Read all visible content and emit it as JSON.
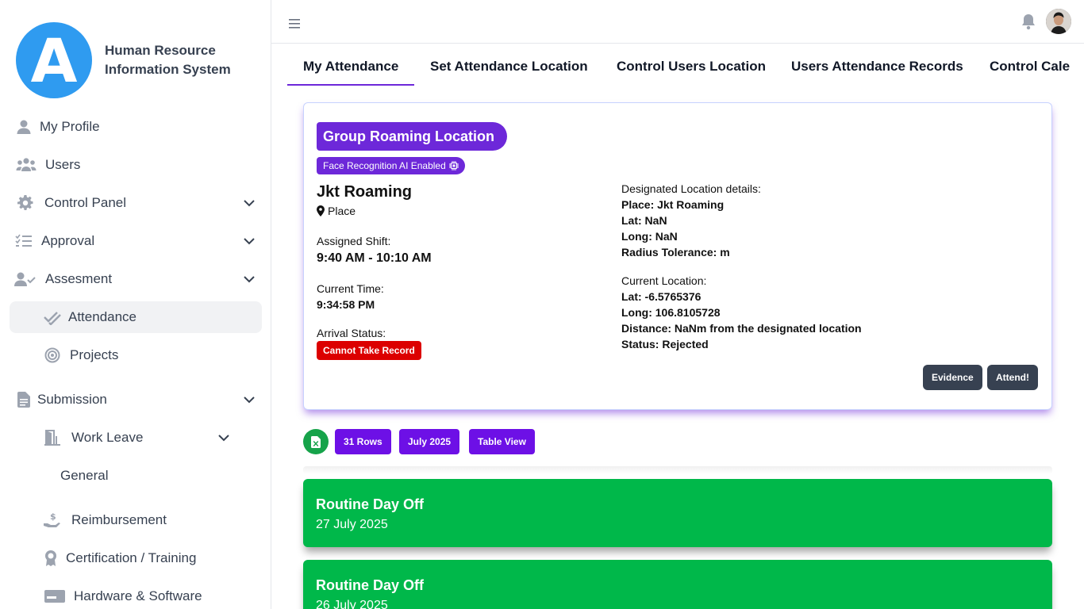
{
  "brand": {
    "logo_letter": "A",
    "title": "Human Resource Information System",
    "logo_color": "#2f9bf0"
  },
  "sidebar": {
    "items": [
      {
        "label": "My Profile",
        "icon": "user-icon"
      },
      {
        "label": "Users",
        "icon": "users-icon"
      },
      {
        "label": "Control Panel",
        "icon": "gear-icon"
      },
      {
        "label": "Approval",
        "icon": "checklist-icon"
      },
      {
        "label": "Assesment",
        "icon": "user-check-icon"
      },
      {
        "label": "Attendance",
        "icon": "double-check-icon"
      },
      {
        "label": "Projects",
        "icon": "target-icon"
      },
      {
        "label": "Submission",
        "icon": "document-icon"
      },
      {
        "label": "Work Leave",
        "icon": "door-icon"
      },
      {
        "label": "General",
        "icon": ""
      },
      {
        "label": "Reimbursement",
        "icon": "hand-dollar-icon"
      },
      {
        "label": "Certification / Training",
        "icon": "award-icon"
      },
      {
        "label": "Hardware & Software",
        "icon": "card-icon"
      }
    ]
  },
  "topbar": {
    "menu_icon": "hamburger-icon",
    "notifications_icon": "bell-icon",
    "avatar": "user-avatar"
  },
  "tabs": [
    {
      "label": "My Attendance",
      "active": true
    },
    {
      "label": "Set Attendance Location"
    },
    {
      "label": "Control Users Location"
    },
    {
      "label": "Users Attendance Records"
    },
    {
      "label": "Control Cale"
    }
  ],
  "card": {
    "group_label": "Group Roaming Location",
    "ai_badge": "Face Recognition AI Enabled",
    "location_name": "Jkt Roaming",
    "place_label": "Place",
    "shift_label": "Assigned Shift:",
    "shift_value": "9:40 AM - 10:10 AM",
    "time_label": "Current Time:",
    "time_value": "9:34:58 PM",
    "arrival_label": "Arrival Status:",
    "arrival_status": "Cannot Take Record",
    "designated": {
      "heading": "Designated Location details:",
      "place": "Place: Jkt Roaming",
      "lat": "Lat: NaN",
      "long": "Long: NaN",
      "radius": "Radius Tolerance: m"
    },
    "current": {
      "heading": "Current Location:",
      "lat": "Lat: -6.5765376",
      "long": "Long: 106.8105728",
      "distance": "Distance: NaNm from the designated location",
      "status": "Status: Rejected"
    },
    "evidence_button": "Evidence",
    "attend_button": "Attend!"
  },
  "toolbar": {
    "excel_icon": "excel-icon",
    "rows_chip": "31 Rows",
    "month_chip": "July 2025",
    "view_chip": "Table View"
  },
  "records": [
    {
      "title": "Routine Day Off",
      "date": "27 July 2025"
    },
    {
      "title": "Routine Day Off",
      "date": "26 July 2025"
    }
  ],
  "colors": {
    "accent": "#6d28d9",
    "chip": "#6d10e6",
    "danger": "#dc0000",
    "success": "#00b84a",
    "dark_button": "#374151"
  }
}
